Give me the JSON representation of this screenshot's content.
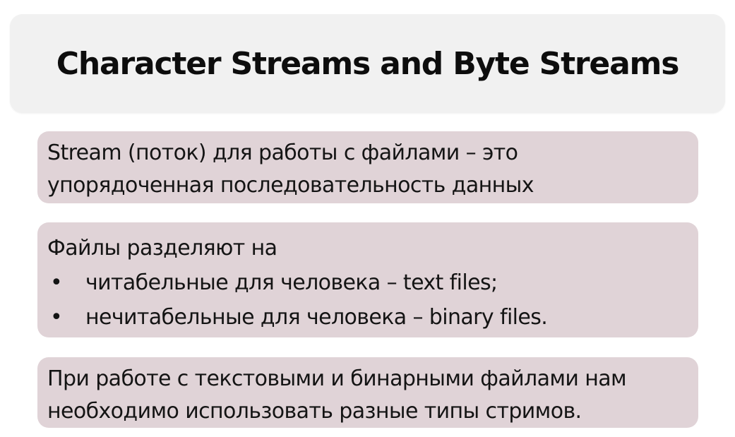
{
  "slide": {
    "title": "Character Streams and Byte Streams",
    "cards": [
      {
        "lines": [
          "Stream (поток) для работы с файлами – это",
          "упорядоченная последовательность данных"
        ]
      },
      {
        "intro": "Файлы разделяют на",
        "bullet_symbol": "•",
        "bullets": [
          "читабельные для человека – text files;",
          "нечитабельные для человека – binary files."
        ]
      },
      {
        "lines": [
          "При работе с текстовыми и бинарными файлами нам",
          "необходимо использовать разные типы стримов."
        ]
      }
    ]
  },
  "colors": {
    "title_background": "#f1f1f1",
    "card_background": "#e0d3d7",
    "text": "#141414"
  }
}
